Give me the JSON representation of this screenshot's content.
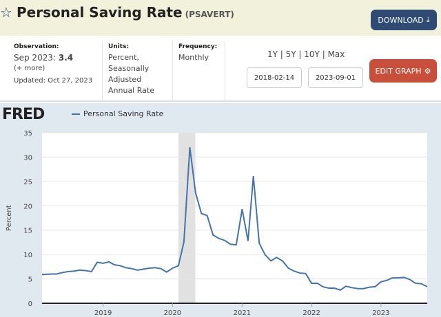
{
  "header": {
    "title": "Personal Saving Rate",
    "series_id": "(PSAVERT)",
    "download_label": "DOWNLOAD",
    "star_icon": "star-outline"
  },
  "info": {
    "observation_label": "Observation:",
    "observation_date": "Sep 2023:",
    "observation_value": "3.4",
    "more": "(+ more)",
    "updated": "Updated: Oct 27, 2023",
    "units_label": "Units:",
    "units_lines": [
      "Percent,",
      "Seasonally",
      "Adjusted",
      "Annual Rate"
    ],
    "frequency_label": "Frequency:",
    "frequency": "Monthly",
    "ranges": [
      "1Y",
      "5Y",
      "10Y",
      "Max"
    ],
    "start_date": "2018-02-14",
    "end_date": "2023-09-01",
    "edit_label": "EDIT GRAPH"
  },
  "colors": {
    "line": "#4572a7",
    "recession": "#e1e1e1",
    "download": "#2f4a73",
    "edit": "#c8503a"
  },
  "chart_data": {
    "type": "line",
    "logo": "FRED",
    "ylabel": "Percent",
    "ylim": [
      0,
      35
    ],
    "yticks": [
      0,
      5,
      10,
      15,
      20,
      25,
      30,
      35
    ],
    "xlim": [
      "2018-02-14",
      "2023-09-01"
    ],
    "xticks": [
      "2019",
      "2020",
      "2021",
      "2022",
      "2023"
    ],
    "grid": true,
    "legend_placement": "top-left",
    "recession": [
      "2020-02-01",
      "2020-04-30"
    ],
    "series": [
      {
        "name": "Personal Saving Rate",
        "start": "2018-03",
        "frequency": "monthly",
        "values": [
          5.9,
          6.0,
          6.0,
          6.3,
          6.5,
          6.6,
          6.8,
          6.7,
          6.5,
          8.4,
          8.2,
          8.5,
          7.9,
          7.7,
          7.3,
          7.1,
          6.8,
          7.0,
          7.2,
          7.3,
          7.1,
          6.4,
          7.2,
          7.7,
          12.6,
          32.0,
          22.7,
          18.4,
          18.0,
          14.0,
          13.3,
          12.9,
          12.1,
          12.0,
          19.3,
          12.8,
          26.1,
          12.3,
          10.0,
          8.7,
          9.4,
          8.7,
          7.2,
          6.6,
          6.2,
          6.1,
          4.1,
          4.1,
          3.4,
          3.1,
          3.1,
          2.7,
          3.5,
          3.2,
          3.0,
          3.0,
          3.3,
          3.4,
          4.4,
          4.7,
          5.2,
          5.2,
          5.3,
          4.9,
          4.1,
          4.0,
          3.4
        ]
      }
    ]
  }
}
